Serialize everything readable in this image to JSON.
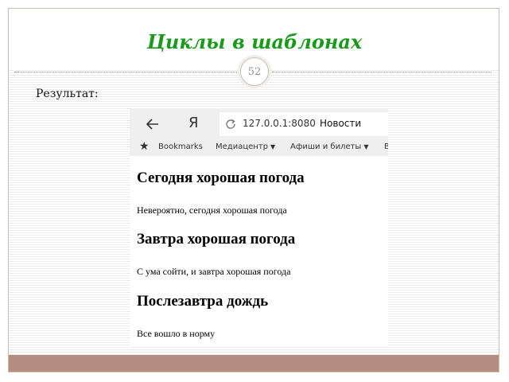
{
  "slide": {
    "title": "Циклы в шаблонах",
    "page_number": "52",
    "result_label": "Результат:"
  },
  "browser": {
    "url": "127.0.0.1:8080",
    "page_title": "Новости",
    "yandex_glyph": "Я",
    "bookmarks": [
      {
        "label": "Bookmarks"
      },
      {
        "label": "Медиацентр",
        "has_dropdown": true
      },
      {
        "label": "Афиши и билеты",
        "has_dropdown": true
      },
      {
        "label": "В"
      }
    ],
    "news": [
      {
        "heading": "Сегодня хорошая погода",
        "text": "Невероятно, сегодня хорошая погода"
      },
      {
        "heading": "Завтра хорошая погода",
        "text": "С ума сойти, и завтра хорошая погода"
      },
      {
        "heading": "Послезавтра дождь",
        "text": "Все вошло в норму"
      }
    ]
  },
  "colors": {
    "title_green": "#1a9a1a",
    "footer_bar": "#b48c80",
    "toolbar_bg": "#efefef"
  }
}
